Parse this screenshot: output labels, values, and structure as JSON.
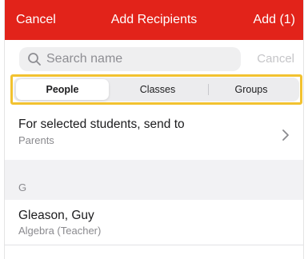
{
  "nav": {
    "cancel": "Cancel",
    "title": "Add Recipients",
    "add": "Add (1)",
    "background_color": "#e2231a"
  },
  "search": {
    "placeholder": "Search name",
    "cancel": "Cancel",
    "icon": "search-icon"
  },
  "segments": [
    {
      "label": "People",
      "selected": true
    },
    {
      "label": "Classes",
      "selected": false
    },
    {
      "label": "Groups",
      "selected": false
    }
  ],
  "highlight_color": "#f2c230",
  "send_row": {
    "title": "For selected students, send to",
    "value": "Parents",
    "icon": "chevron-right-icon"
  },
  "section": {
    "header": "G"
  },
  "recipients": [
    {
      "name": "Gleason, Guy",
      "detail": "Algebra (Teacher)"
    }
  ]
}
